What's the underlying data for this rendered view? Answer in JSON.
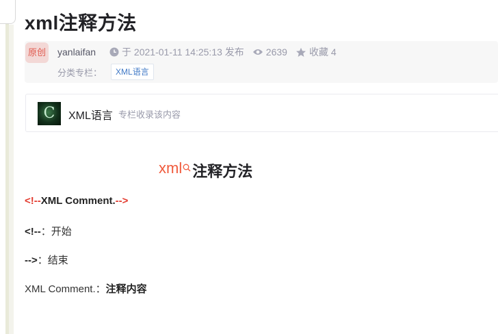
{
  "article": {
    "title": "xml注释方法",
    "heading_highlight": "xml",
    "heading_rest": "注释方法"
  },
  "meta": {
    "badge": "原创",
    "author": "yanlaifan",
    "date": "于 2021-01-11 14:25:13 发布",
    "views": "2639",
    "favorites": "收藏 4",
    "category_label": "分类专栏：",
    "category_tag": "XML语言"
  },
  "column": {
    "thumb_letter": "C",
    "name": "XML语言",
    "desc": "专栏收录该内容"
  },
  "content": {
    "line1_open": "<!--",
    "line1_mid": "XML Comment.",
    "line1_close": "-->",
    "line2_code": "<!--",
    "line2_text": "：开始",
    "line3_code": "-->",
    "line3_text": "：结束",
    "line4_text": "XML Comment.：",
    "line4_bold": "注释内容"
  },
  "colors": {
    "accent_red": "#e33a2e",
    "highlight": "#f05a3c",
    "tag_blue": "#3f78c6"
  },
  "icons": [
    "clock-icon",
    "eye-icon",
    "star-icon",
    "search-icon"
  ]
}
